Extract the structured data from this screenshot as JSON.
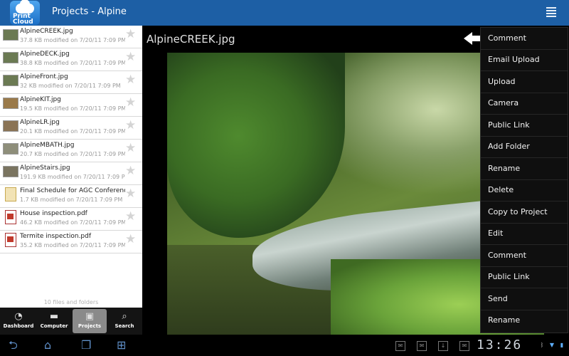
{
  "app": {
    "logo_line1": "Print",
    "logo_line2": "Cloud",
    "title": "Projects - Alpine"
  },
  "files": [
    {
      "name": "AlpineCREEK.jpg",
      "meta": "37.8 KB modified on 7/20/11 7:09 PM",
      "type": "image"
    },
    {
      "name": "AlpineDECK.jpg",
      "meta": "38.8 KB modified on 7/20/11 7:09 PM",
      "type": "image"
    },
    {
      "name": "AlpineFront.jpg",
      "meta": "32 KB modified on 7/20/11 7:09 PM",
      "type": "image"
    },
    {
      "name": "AlpineKIT.jpg",
      "meta": "19.5 KB modified on 7/20/11 7:09 PM",
      "type": "image"
    },
    {
      "name": "AlpineLR.jpg",
      "meta": "20.1 KB modified on 7/20/11 7:09 PM",
      "type": "image"
    },
    {
      "name": "AlpineMBATH.jpg",
      "meta": "20.7 KB modified on 7/20/11 7:09 PM",
      "type": "image"
    },
    {
      "name": "AlpineStairs.jpg",
      "meta": "191.9 KB modified on 7/20/11 7:09 PM",
      "type": "image"
    },
    {
      "name": "Final Schedule for AGC Conference Tr",
      "meta": "1.7 KB modified on 7/20/11 7:09 PM",
      "type": "doc"
    },
    {
      "name": "House inspection.pdf",
      "meta": "46.2 KB modified on 7/20/11 7:09 PM",
      "type": "pdf"
    },
    {
      "name": "Termite inspection.pdf",
      "meta": "35.2 KB modified on 7/20/11 7:09 PM",
      "type": "pdf"
    }
  ],
  "file_count": "10 files and folders",
  "nav": [
    {
      "label": "Dashboard",
      "icon": "dashboard-icon",
      "selected": false
    },
    {
      "label": "Computer",
      "icon": "folder-icon",
      "selected": false
    },
    {
      "label": "Projects",
      "icon": "projects-icon",
      "selected": true
    },
    {
      "label": "Search",
      "icon": "search-icon",
      "selected": false
    }
  ],
  "viewer": {
    "title": "AlpineCREEK.jpg"
  },
  "menu": [
    "Comment",
    "Email Upload",
    "Upload",
    "Camera",
    "Public Link",
    "Add Folder",
    "Rename",
    "Delete",
    "Copy to Project",
    "Edit",
    "Comment",
    "Public Link",
    "Send",
    "Rename"
  ],
  "system": {
    "clock": "13:26"
  },
  "colors": {
    "titlebar": "#1d5fa5",
    "menu_bg": "#0f0f0f",
    "system_buttons": "#5f8fc8"
  }
}
